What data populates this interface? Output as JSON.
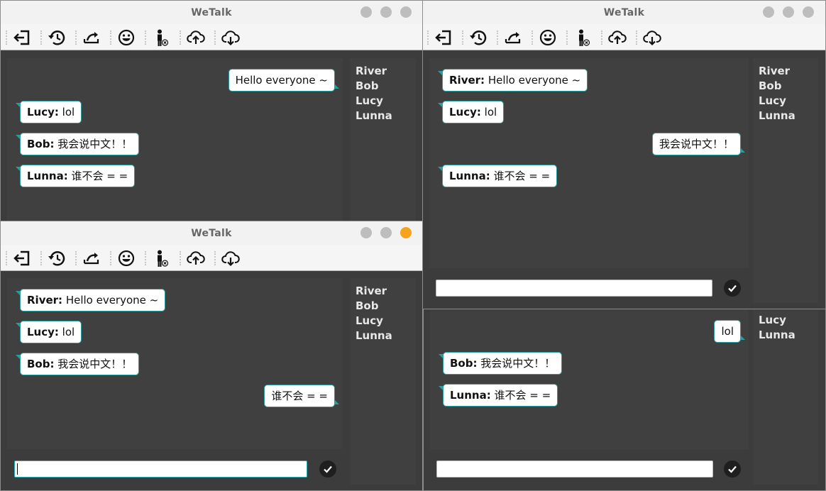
{
  "app": {
    "title": "WeTalk",
    "toolbar_icons": [
      "exit-icon",
      "history-icon",
      "share-icon",
      "emoji-icon",
      "user-status-icon",
      "upload-icon",
      "download-icon"
    ],
    "colors": {
      "bubble_border": "#2a9d9d",
      "window_bg": "#3c3c3c",
      "active_close": "#f6a31b"
    }
  },
  "users": [
    "River",
    "Bob",
    "Lucy",
    "Lunna"
  ],
  "window_river": {
    "messages": [
      {
        "sender": "",
        "text": "Hello everyone ~"
      },
      {
        "sender": "Lucy:",
        "text": " lol"
      },
      {
        "sender": "Bob:",
        "text": " 我会说中文！！"
      },
      {
        "sender": "Lunna:",
        "text": " 谁不会 = ="
      }
    ]
  },
  "window_lunna": {
    "messages": [
      {
        "sender": "River:",
        "text": " Hello everyone ~"
      },
      {
        "sender": "Lucy:",
        "text": " lol"
      },
      {
        "sender": "Bob:",
        "text": " 我会说中文！！"
      },
      {
        "sender": "",
        "text": "谁不会 = ="
      }
    ],
    "input_value": ""
  },
  "window_bob": {
    "messages": [
      {
        "sender": "River:",
        "text": " Hello everyone ~"
      },
      {
        "sender": "Lucy:",
        "text": " lol"
      },
      {
        "sender": "",
        "text": "我会说中文！！"
      },
      {
        "sender": "Lunna:",
        "text": " 谁不会 = ="
      }
    ],
    "input_value": ""
  },
  "window_lucy": {
    "visible_users": [
      "Lucy",
      "Lunna"
    ],
    "messages": [
      {
        "sender": "",
        "text": "lol"
      },
      {
        "sender": "Bob:",
        "text": " 我会说中文！！"
      },
      {
        "sender": "Lunna:",
        "text": " 谁不会 = ="
      }
    ],
    "input_value": ""
  }
}
